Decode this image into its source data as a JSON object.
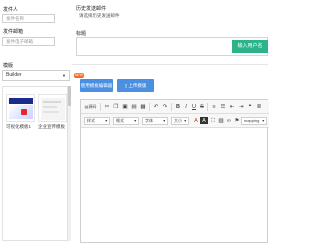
{
  "left": {
    "sender_label": "发件人",
    "sender_placeholder": "发件名称",
    "sender_email_label": "发件邮箱",
    "sender_email_placeholder": "发件电子邮箱",
    "template_label": "模版",
    "template_select": "Builder",
    "templates": [
      {
        "caption": "可视化模板1"
      },
      {
        "caption": "企业宣传模板"
      }
    ]
  },
  "right": {
    "history_label": "历史发送邮件",
    "history_placeholder": "请选择历史发送邮件",
    "subject_label": "标题",
    "add_personalization_button": "输入用户名",
    "new_badge": "NEW",
    "visual_editor_button": "使用模板编辑器",
    "upload_template_button": "上传模版"
  },
  "editor": {
    "source_label": "源码",
    "dropdowns": {
      "style": "样式",
      "format": "格式",
      "font": "字体",
      "size": "大小",
      "mapping": "mapping"
    }
  },
  "colors": {
    "accent_green": "#2cb38a",
    "accent_blue": "#4a8fe0",
    "badge_orange": "#f26b2a"
  }
}
